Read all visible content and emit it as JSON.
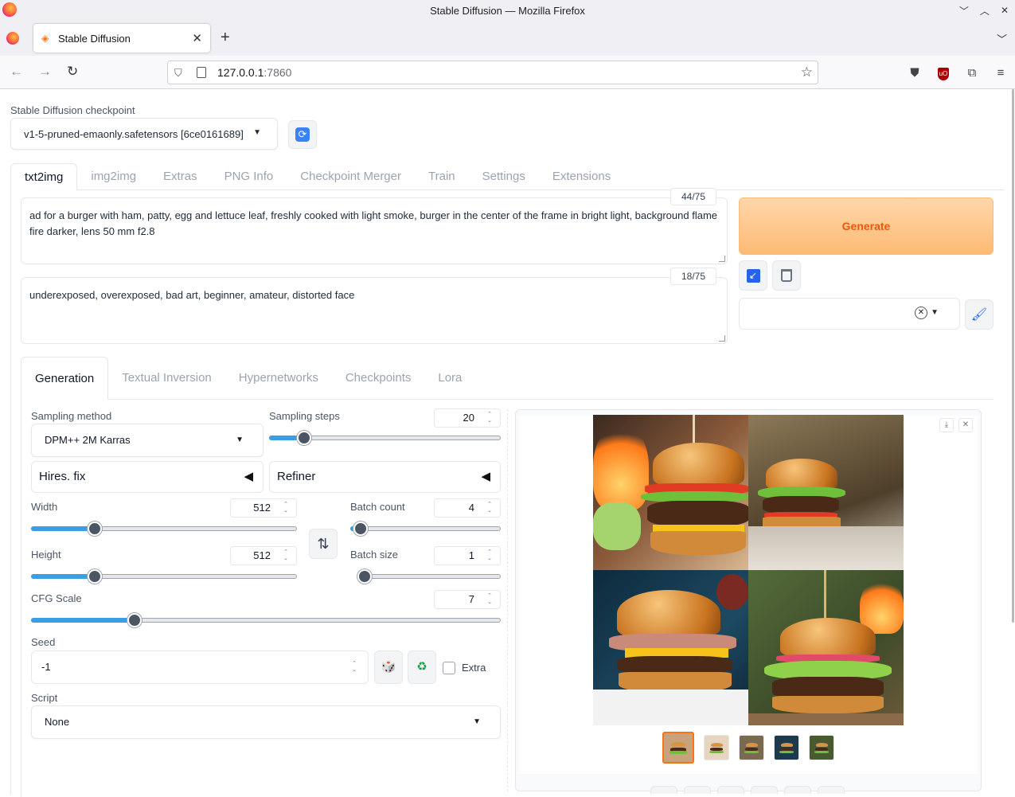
{
  "window": {
    "title": "Stable Diffusion — Mozilla Firefox"
  },
  "browser": {
    "tab_title": "Stable Diffusion",
    "url_host": "127.0.0.1",
    "url_port": ":7860"
  },
  "checkpoint": {
    "label": "Stable Diffusion checkpoint",
    "value": "v1-5-pruned-emaonly.safetensors [6ce0161689]"
  },
  "main_tabs": [
    "txt2img",
    "img2img",
    "Extras",
    "PNG Info",
    "Checkpoint Merger",
    "Train",
    "Settings",
    "Extensions"
  ],
  "prompt": {
    "text": "ad for a burger with ham, patty, egg and lettuce leaf, freshly cooked with light smoke, burger in the center of the frame in bright light, background flame fire darker, lens 50 mm f2.8",
    "token_count": "44/75"
  },
  "negative_prompt": {
    "text": "underexposed, overexposed, bad art, beginner, amateur, distorted face",
    "token_count": "18/75"
  },
  "generate_label": "Generate",
  "sub_tabs": [
    "Generation",
    "Textual Inversion",
    "Hypernetworks",
    "Checkpoints",
    "Lora"
  ],
  "generation": {
    "sampling_method_label": "Sampling method",
    "sampling_method": "DPM++ 2M Karras",
    "sampling_steps_label": "Sampling steps",
    "sampling_steps": "20",
    "sampling_steps_frac": 0.15,
    "hires_fix": "Hires. fix",
    "refiner": "Refiner",
    "width_label": "Width",
    "width": "512",
    "width_frac": 0.24,
    "height_label": "Height",
    "height": "512",
    "height_frac": 0.24,
    "batch_count_label": "Batch count",
    "batch_count": "4",
    "batch_count_frac": 0.07,
    "batch_size_label": "Batch size",
    "batch_size": "1",
    "batch_size_frac": 0.0,
    "cfg_label": "CFG Scale",
    "cfg": "7",
    "cfg_frac": 0.22,
    "seed_label": "Seed",
    "seed": "-1",
    "extra_label": "Extra",
    "script_label": "Script",
    "script": "None"
  },
  "colors": {
    "accent_orange": "#f97316",
    "slider_fill": "#3b9ee3",
    "generate_bg": "#fdba74"
  }
}
